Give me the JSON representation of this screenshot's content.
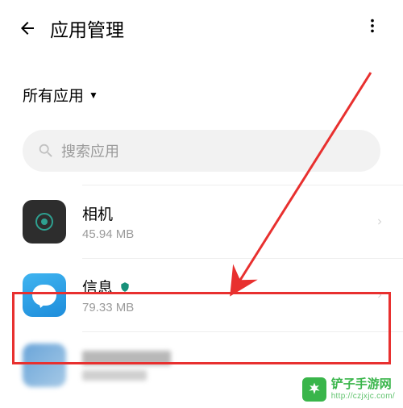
{
  "header": {
    "title": "应用管理"
  },
  "filter": {
    "label": "所有应用"
  },
  "search": {
    "placeholder": "搜索应用"
  },
  "apps": [
    {
      "name": "相机",
      "size": "45.94 MB",
      "has_shield": false
    },
    {
      "name": "信息",
      "size": "79.33 MB",
      "has_shield": true
    }
  ],
  "watermark": {
    "brand": "铲子手游网",
    "url": "http://czjxjc.com/"
  },
  "annotation": {
    "highlight_color": "#e8302f"
  }
}
